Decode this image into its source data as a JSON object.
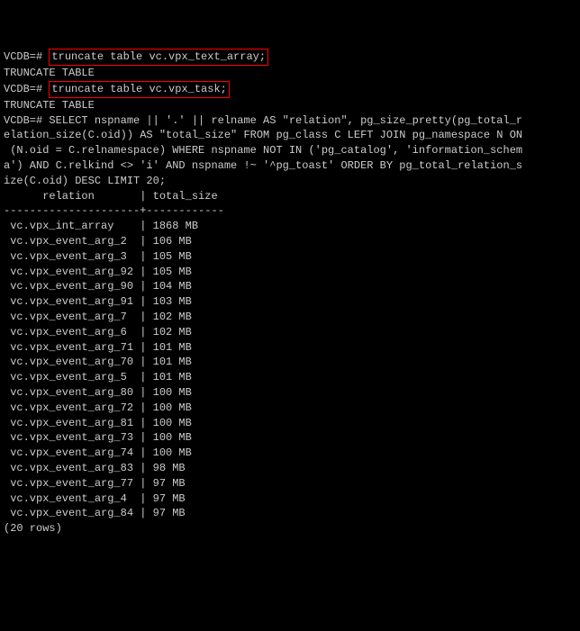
{
  "lines": [
    {
      "prompt": "VCDB=# ",
      "boxed": "truncate table vc.vpx_text_array;"
    },
    {
      "text": "TRUNCATE TABLE"
    },
    {
      "prompt": "VCDB=# ",
      "boxed": "truncate table vc.vpx_task;"
    },
    {
      "text": "TRUNCATE TABLE"
    },
    {
      "text": "VCDB=# SELECT nspname || '.' || relname AS \"relation\", pg_size_pretty(pg_total_r"
    },
    {
      "text": "elation_size(C.oid)) AS \"total_size\" FROM pg_class C LEFT JOIN pg_namespace N ON"
    },
    {
      "text": " (N.oid = C.relnamespace) WHERE nspname NOT IN ('pg_catalog', 'information_schem"
    },
    {
      "text": "a') AND C.relkind <> 'i' AND nspname !~ '^pg_toast' ORDER BY pg_total_relation_s"
    },
    {
      "text": "ize(C.oid) DESC LIMIT 20;"
    },
    {
      "text": "      relation       | total_size"
    },
    {
      "text": "---------------------+------------"
    },
    {
      "text": " vc.vpx_int_array    | 1868 MB"
    },
    {
      "text": " vc.vpx_event_arg_2  | 106 MB"
    },
    {
      "text": " vc.vpx_event_arg_3  | 105 MB"
    },
    {
      "text": " vc.vpx_event_arg_92 | 105 MB"
    },
    {
      "text": " vc.vpx_event_arg_90 | 104 MB"
    },
    {
      "text": " vc.vpx_event_arg_91 | 103 MB"
    },
    {
      "text": " vc.vpx_event_arg_7  | 102 MB"
    },
    {
      "text": " vc.vpx_event_arg_6  | 102 MB"
    },
    {
      "text": " vc.vpx_event_arg_71 | 101 MB"
    },
    {
      "text": " vc.vpx_event_arg_70 | 101 MB"
    },
    {
      "text": " vc.vpx_event_arg_5  | 101 MB"
    },
    {
      "text": " vc.vpx_event_arg_80 | 100 MB"
    },
    {
      "text": " vc.vpx_event_arg_72 | 100 MB"
    },
    {
      "text": " vc.vpx_event_arg_81 | 100 MB"
    },
    {
      "text": " vc.vpx_event_arg_73 | 100 MB"
    },
    {
      "text": " vc.vpx_event_arg_74 | 100 MB"
    },
    {
      "text": " vc.vpx_event_arg_83 | 98 MB"
    },
    {
      "text": " vc.vpx_event_arg_77 | 97 MB"
    },
    {
      "text": " vc.vpx_event_arg_4  | 97 MB"
    },
    {
      "text": " vc.vpx_event_arg_84 | 97 MB"
    },
    {
      "text": "(20 rows)"
    },
    {
      "text": ""
    }
  ],
  "chart_data": {
    "type": "table",
    "columns": [
      "relation",
      "total_size"
    ],
    "rows": [
      [
        "vc.vpx_int_array",
        "1868 MB"
      ],
      [
        "vc.vpx_event_arg_2",
        "106 MB"
      ],
      [
        "vc.vpx_event_arg_3",
        "105 MB"
      ],
      [
        "vc.vpx_event_arg_92",
        "105 MB"
      ],
      [
        "vc.vpx_event_arg_90",
        "104 MB"
      ],
      [
        "vc.vpx_event_arg_91",
        "103 MB"
      ],
      [
        "vc.vpx_event_arg_7",
        "102 MB"
      ],
      [
        "vc.vpx_event_arg_6",
        "102 MB"
      ],
      [
        "vc.vpx_event_arg_71",
        "101 MB"
      ],
      [
        "vc.vpx_event_arg_70",
        "101 MB"
      ],
      [
        "vc.vpx_event_arg_5",
        "101 MB"
      ],
      [
        "vc.vpx_event_arg_80",
        "100 MB"
      ],
      [
        "vc.vpx_event_arg_72",
        "100 MB"
      ],
      [
        "vc.vpx_event_arg_81",
        "100 MB"
      ],
      [
        "vc.vpx_event_arg_73",
        "100 MB"
      ],
      [
        "vc.vpx_event_arg_74",
        "100 MB"
      ],
      [
        "vc.vpx_event_arg_83",
        "98 MB"
      ],
      [
        "vc.vpx_event_arg_77",
        "97 MB"
      ],
      [
        "vc.vpx_event_arg_4",
        "97 MB"
      ],
      [
        "vc.vpx_event_arg_84",
        "97 MB"
      ]
    ],
    "row_count": 20
  }
}
